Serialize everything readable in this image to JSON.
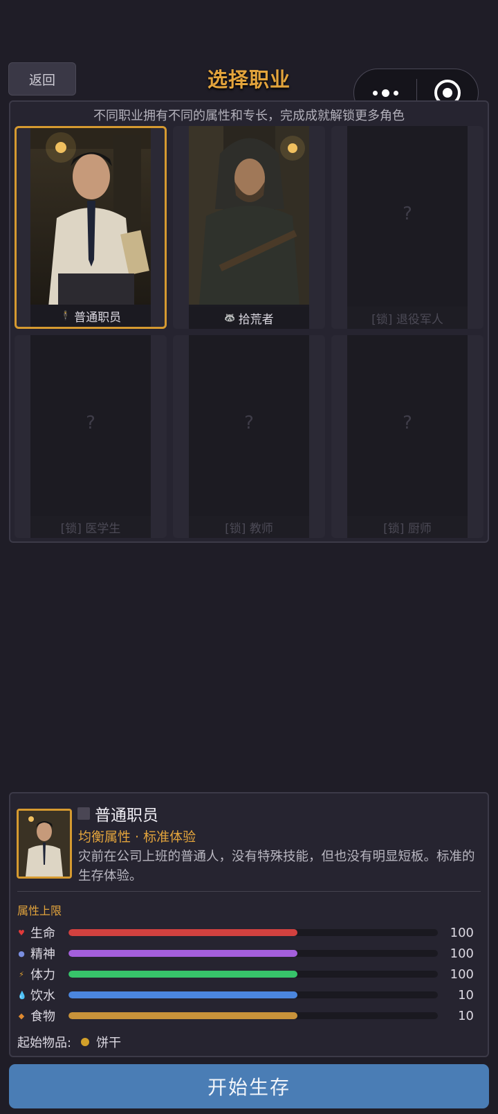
{
  "header": {
    "back_label": "返回",
    "title": "选择职业"
  },
  "panel": {
    "subtitle": "不同职业拥有不同的属性和专长，完成成就解锁更多角色"
  },
  "classes": [
    {
      "label": "普通职员",
      "locked": false,
      "selected": true
    },
    {
      "label": "拾荒者",
      "locked": false,
      "selected": false
    },
    {
      "label": "[锁] 退役军人",
      "locked": true,
      "placeholder": "?"
    },
    {
      "label": "[锁] 医学生",
      "locked": true,
      "placeholder": "?"
    },
    {
      "label": "[锁] 教师",
      "locked": true,
      "placeholder": "?"
    },
    {
      "label": "[锁] 厨师",
      "locked": true,
      "placeholder": "?"
    }
  ],
  "detail": {
    "name": "普通职员",
    "tagline": "均衡属性 · 标准体验",
    "description": "灾前在公司上班的普通人，没有特殊技能，但也没有明显短板。标准的生存体验。",
    "stats_title": "属性上限",
    "stats": [
      {
        "label": "生命",
        "value": "100",
        "fill": 0.62,
        "color": "#d2413f",
        "icon": "heart-icon"
      },
      {
        "label": "精神",
        "value": "100",
        "fill": 0.62,
        "color": "#a45fdc",
        "icon": "brain-icon"
      },
      {
        "label": "体力",
        "value": "100",
        "fill": 0.62,
        "color": "#37c46a",
        "icon": "energy-icon"
      },
      {
        "label": "饮水",
        "value": "10",
        "fill": 0.62,
        "color": "#4b86de",
        "icon": "water-drop-icon"
      },
      {
        "label": "食物",
        "value": "10",
        "fill": 0.62,
        "color": "#c8923a",
        "icon": "food-icon"
      }
    ],
    "start_items_label": "起始物品:",
    "start_item": "饼干"
  },
  "start_button": "开始生存"
}
